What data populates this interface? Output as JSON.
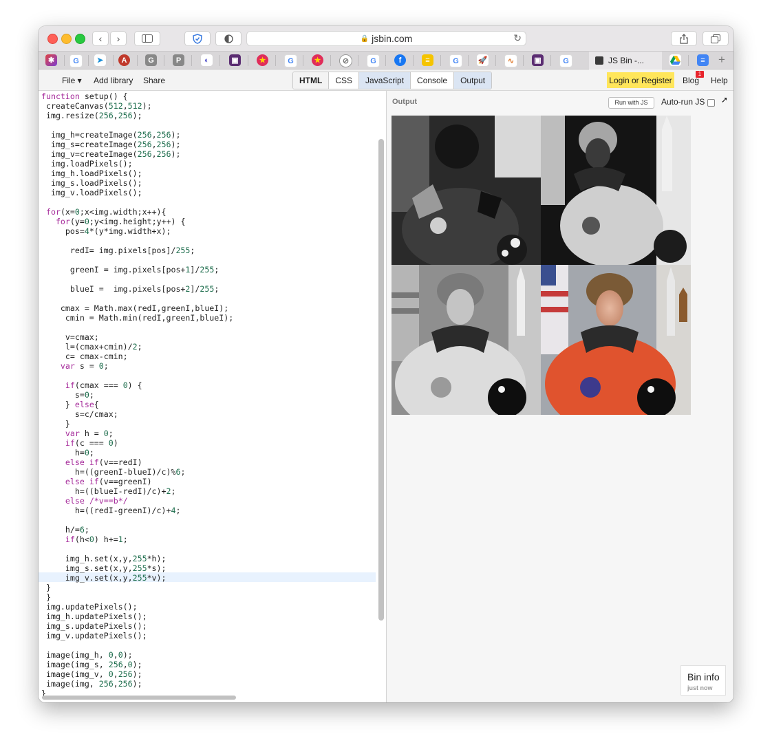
{
  "browser": {
    "url": "jsbin.com",
    "active_tab_title": "JS Bin -..."
  },
  "menu": {
    "file": "File ▾",
    "add_library": "Add library",
    "share": "Share",
    "panels": [
      "HTML",
      "CSS",
      "JavaScript",
      "Console",
      "Output"
    ],
    "login": "Login or Register",
    "blog": "Blog",
    "blog_badge": "1",
    "help": "Help"
  },
  "output": {
    "label": "Output",
    "run_button": "Run with JS",
    "autorun_label": "Auto-run JS"
  },
  "bin_info": {
    "title": "Bin info",
    "subtitle": "just now"
  },
  "editor": {
    "lines": [
      "function setup() {",
      " createCanvas(512,512);",
      " img.resize(256,256);",
      "",
      "  img_h=createImage(256,256);",
      "  img_s=createImage(256,256);",
      "  img_v=createImage(256,256);",
      "  img.loadPixels();",
      "  img_h.loadPixels();",
      "  img_s.loadPixels();",
      "  img_v.loadPixels();",
      "",
      " for(x=0;x<img.width;x++){",
      "   for(y=0;y<img.height;y++) {",
      "     pos=4*(y*img.width+x);",
      "",
      "      redI= img.pixels[pos]/255;",
      "",
      "      greenI = img.pixels[pos+1]/255;",
      "",
      "      blueI =  img.pixels[pos+2]/255;",
      "",
      "    cmax = Math.max(redI,greenI,blueI);",
      "     cmin = Math.min(redI,greenI,blueI);",
      "",
      "     v=cmax;",
      "     l=(cmax+cmin)/2;",
      "     c= cmax-cmin;",
      "    var s = 0;",
      "",
      "     if(cmax === 0) {",
      "       s=0;",
      "     } else{",
      "       s=c/cmax;",
      "     }",
      "     var h = 0;",
      "     if(c === 0)",
      "       h=0;",
      "     else if(v==redI)",
      "       h=((greenI-blueI)/c)%6;",
      "     else if(v==greenI)",
      "       h=((blueI-redI)/c)+2;",
      "     else /*v==b*/",
      "       h=((redI-greenI)/c)+4;",
      "",
      "     h/=6;",
      "     if(h<0) h+=1;",
      "",
      "     img_h.set(x,y,255*h);",
      "     img_s.set(x,y,255*s);",
      "     img_v.set(x,y,255*v);",
      " }",
      " }",
      " img.updatePixels();",
      " img_h.updatePixels();",
      " img_s.updatePixels();",
      " img_v.updatePixels();",
      "",
      " image(img_h, 0,0);",
      " image(img_s, 256,0);",
      " image(img_v, 0,256);",
      " image(img, 256,256);",
      "}"
    ]
  },
  "accent_colors": {
    "login_bg": "#ffe65b",
    "badge": "#e8242c",
    "active_panel": "#dbe5f3"
  }
}
